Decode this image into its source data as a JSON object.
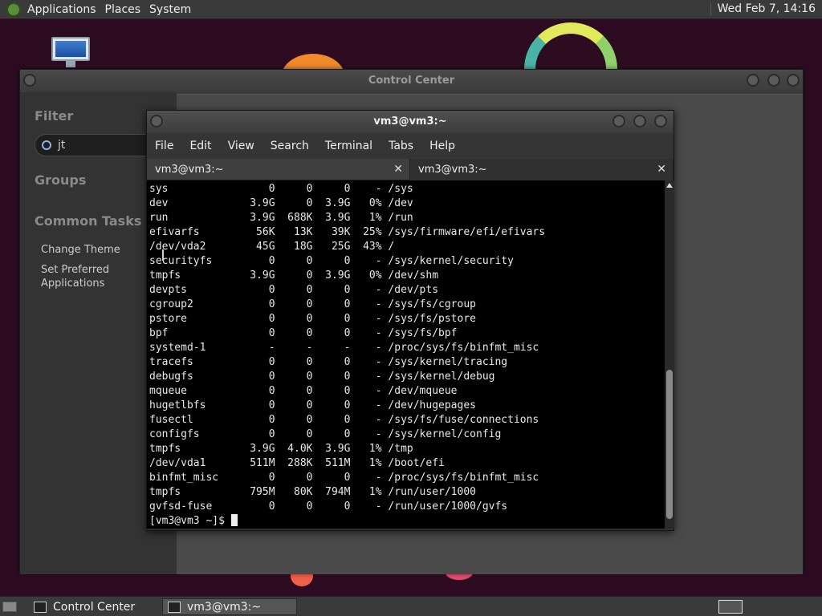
{
  "top_panel": {
    "menus": [
      "Applications",
      "Places",
      "System"
    ],
    "clock": "Wed Feb  7, 14:16"
  },
  "control_center": {
    "title": "Control Center",
    "filter_heading": "Filter",
    "search_value": "jt",
    "groups_heading": "Groups",
    "common_tasks_heading": "Common Tasks",
    "tasks": [
      "Change Theme",
      "Set Preferred Applications"
    ]
  },
  "terminal": {
    "title": "vm3@vm3:~",
    "menu": [
      "File",
      "Edit",
      "View",
      "Search",
      "Terminal",
      "Tabs",
      "Help"
    ],
    "tabs": [
      "vm3@vm3:~",
      "vm3@vm3:~"
    ],
    "lines": [
      "sys                0     0     0    - /sys",
      "dev             3.9G     0  3.9G   0% /dev",
      "run             3.9G  688K  3.9G   1% /run",
      "efivarfs         56K   13K   39K  25% /sys/firmware/efi/efivars",
      "/dev/vda2        45G   18G   25G  43% /",
      "securityfs         0     0     0    - /sys/kernel/security",
      "tmpfs           3.9G     0  3.9G   0% /dev/shm",
      "devpts             0     0     0    - /dev/pts",
      "cgroup2            0     0     0    - /sys/fs/cgroup",
      "pstore             0     0     0    - /sys/fs/pstore",
      "bpf                0     0     0    - /sys/fs/bpf",
      "systemd-1          -     -     -    - /proc/sys/fs/binfmt_misc",
      "tracefs            0     0     0    - /sys/kernel/tracing",
      "debugfs            0     0     0    - /sys/kernel/debug",
      "mqueue             0     0     0    - /dev/mqueue",
      "hugetlbfs          0     0     0    - /dev/hugepages",
      "fusectl            0     0     0    - /sys/fs/fuse/connections",
      "configfs           0     0     0    - /sys/kernel/config",
      "tmpfs           3.9G  4.0K  3.9G   1% /tmp",
      "/dev/vda1       511M  288K  511M   1% /boot/efi",
      "binfmt_misc        0     0     0    - /proc/sys/fs/binfmt_misc",
      "tmpfs           795M   80K  794M   1% /run/user/1000",
      "gvfsd-fuse         0     0     0    - /run/user/1000/gvfs"
    ],
    "prompt": "[vm3@vm3 ~]$ "
  },
  "taskbar": {
    "items": [
      "Control Center",
      "vm3@vm3:~"
    ]
  }
}
